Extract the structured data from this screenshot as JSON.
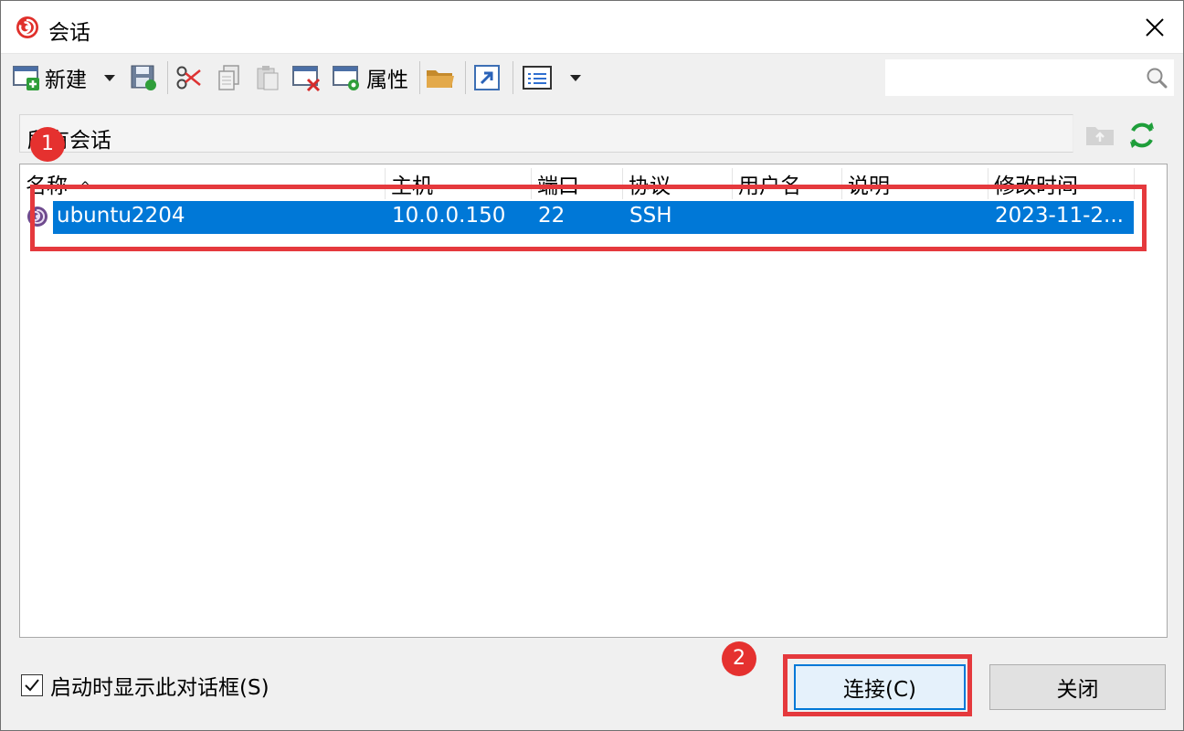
{
  "window": {
    "title": "会话"
  },
  "toolbar": {
    "new_label": "新建",
    "properties_label": "属性",
    "search_placeholder": ""
  },
  "path": {
    "label": "所有会话"
  },
  "table": {
    "columns": [
      "名称",
      "主机",
      "端口",
      "协议",
      "用户名",
      "说明",
      "修改时间"
    ],
    "sort_indicator": "^",
    "rows": [
      {
        "name": "ubuntu2204",
        "host": "10.0.0.150",
        "port": "22",
        "protocol": "SSH",
        "username": "",
        "description": "",
        "modified": "2023-11-2..."
      }
    ]
  },
  "annotations": {
    "badge_1": "1",
    "badge_2": "2"
  },
  "footer": {
    "show_on_startup_label": "启动时显示此对话框(S)",
    "show_on_startup_checked": true,
    "connect_label": "连接(C)",
    "close_label": "关闭"
  },
  "colors": {
    "selection": "#0078d7",
    "highlight": "#e5393d",
    "badge": "#e5312f",
    "refresh": "#1e9e3a"
  }
}
